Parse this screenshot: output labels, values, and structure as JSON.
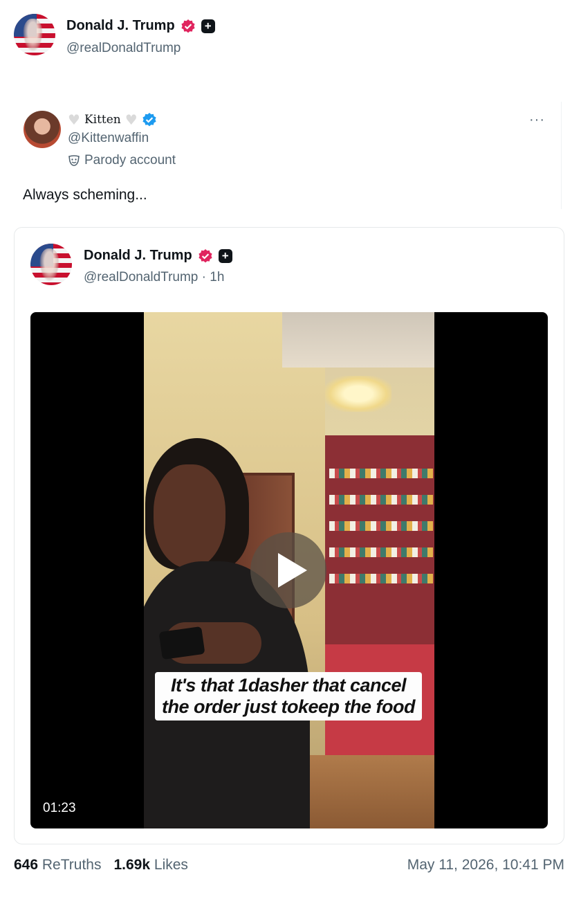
{
  "header": {
    "name": "Donald J. Trump",
    "handle": "@realDonaldTrump"
  },
  "quote_post": {
    "name": "Kitten",
    "handle": "@Kittenwaffin",
    "parody_label": "Parody account",
    "text": "Always scheming...",
    "more_label": "···"
  },
  "embedded_post": {
    "name": "Donald J. Trump",
    "handle": "@realDonaldTrump",
    "time": "· 1h",
    "video": {
      "caption": "It's that 1dasher that cancel the order just tokeep the food",
      "duration": "01:23"
    }
  },
  "stats": {
    "retruths_count": "646",
    "retruths_label": "ReTruths",
    "likes_count": "1.69k",
    "likes_label": "Likes",
    "timestamp": "May 11, 2026, 10:41 PM"
  },
  "colors": {
    "verified_badge": "#e0245e",
    "blue_check": "#1d9bf0",
    "muted_text": "#536471"
  },
  "icons": [
    "verified-badge-icon",
    "plus-badge-icon",
    "heart-icon",
    "blue-check-icon",
    "parody-mask-icon",
    "more-icon",
    "play-icon"
  ]
}
